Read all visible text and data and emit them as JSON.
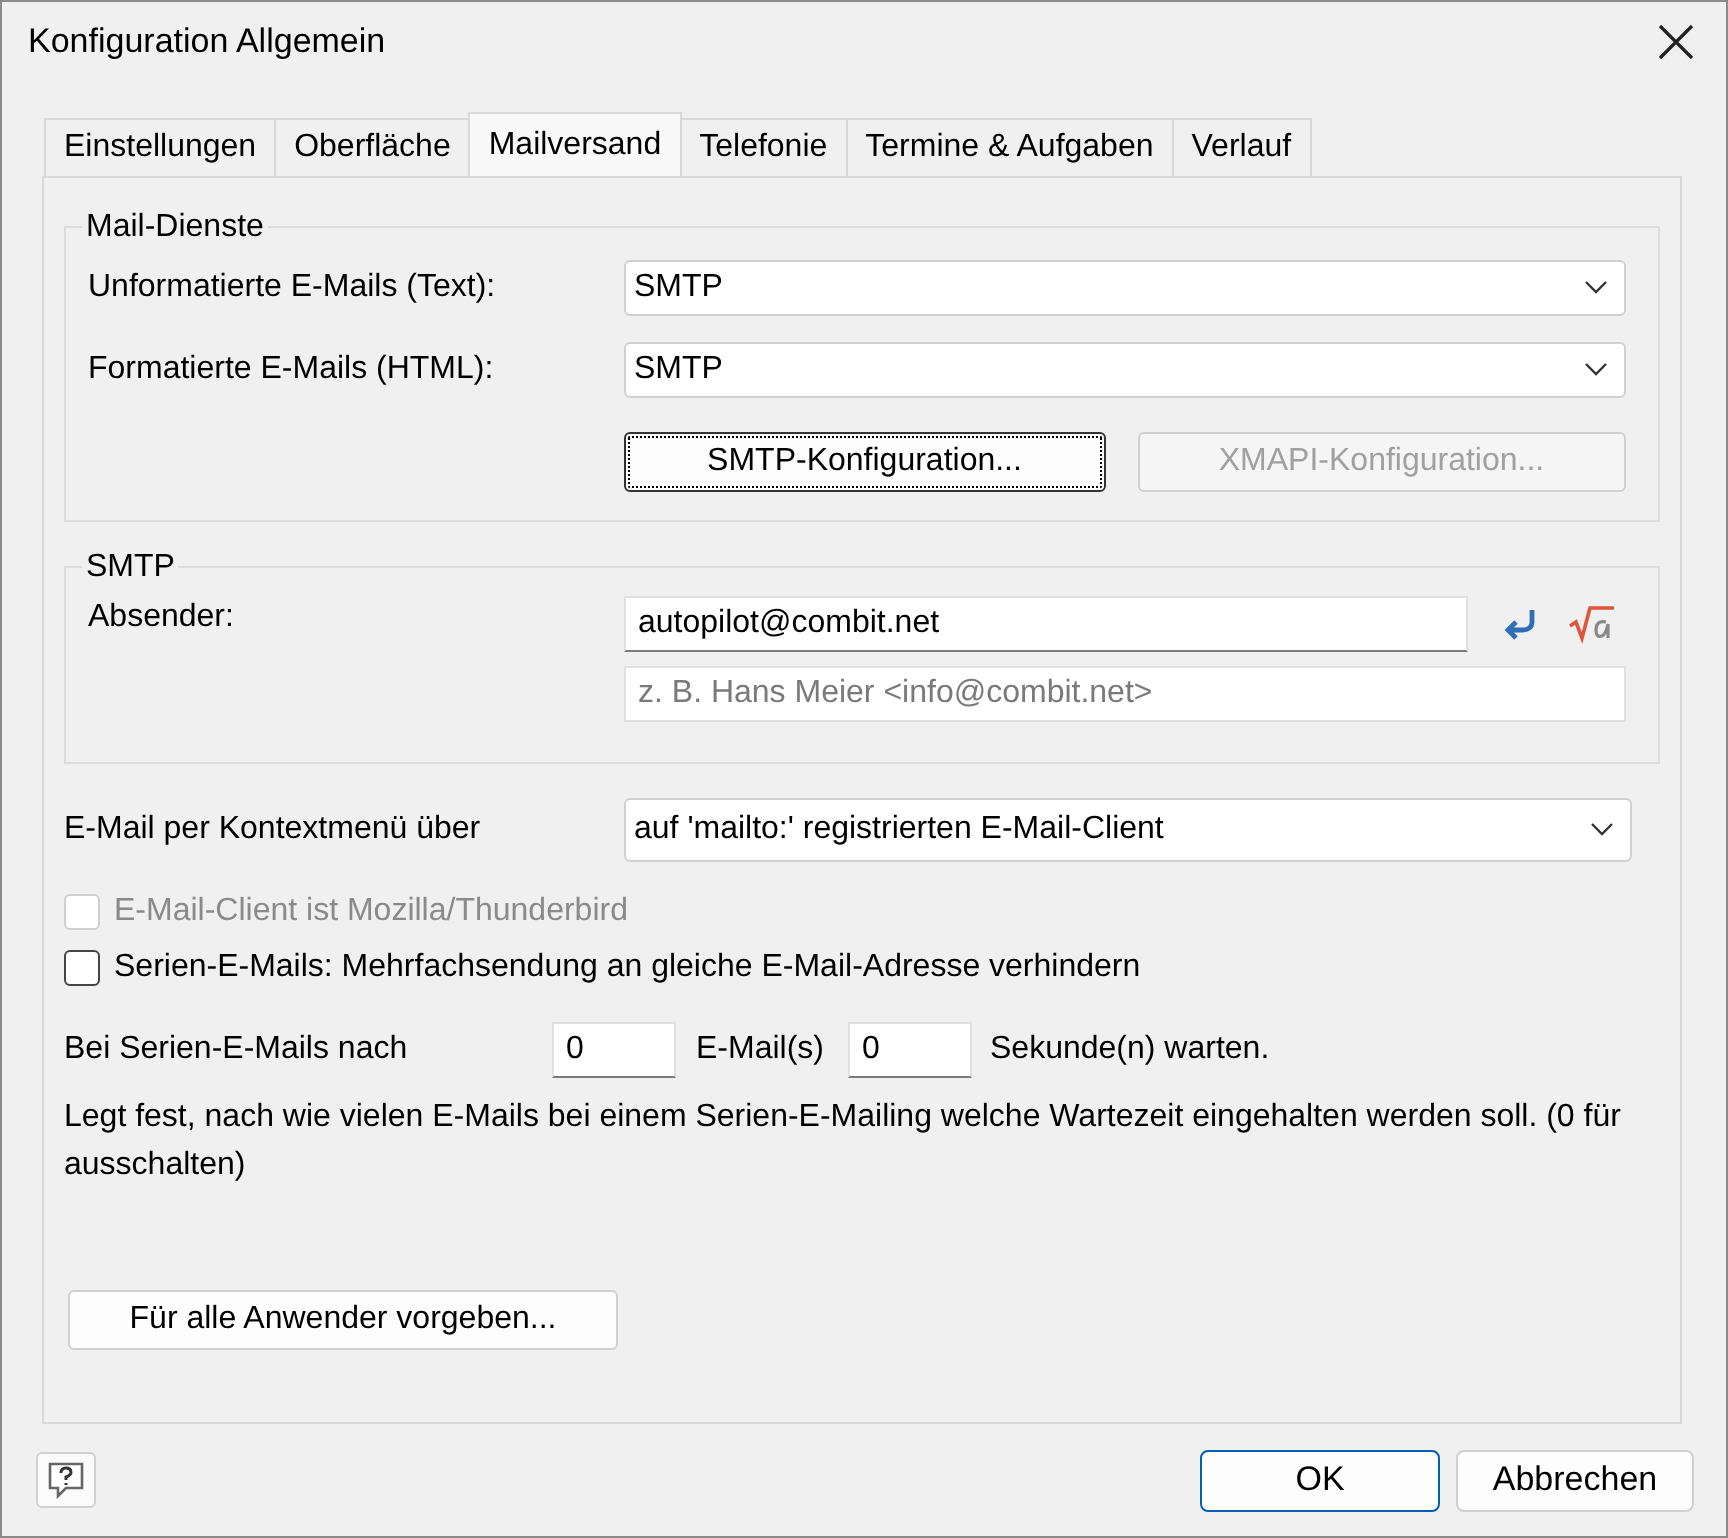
{
  "window": {
    "title": "Konfiguration Allgemein"
  },
  "tabs": [
    {
      "label": "Einstellungen",
      "selected": false
    },
    {
      "label": "Oberfläche",
      "selected": false
    },
    {
      "label": "Mailversand",
      "selected": true
    },
    {
      "label": "Telefonie",
      "selected": false
    },
    {
      "label": "Termine & Aufgaben",
      "selected": false
    },
    {
      "label": "Verlauf",
      "selected": false
    }
  ],
  "mail_services": {
    "title": "Mail-Dienste",
    "rows": [
      {
        "label": "Unformatierte E-Mails (Text):",
        "value": "SMTP"
      },
      {
        "label": "Formatierte E-Mails (HTML):",
        "value": "SMTP"
      }
    ],
    "buttons": [
      {
        "label": "SMTP-Konfiguration...",
        "disabled": false,
        "focused": true
      },
      {
        "label": "XMAPI-Konfiguration...",
        "disabled": true,
        "focused": false
      }
    ]
  },
  "smtp": {
    "title": "SMTP",
    "sender_label": "Absender:",
    "sender_value": "autopilot@combit.net",
    "name_placeholder": "z. B. Hans Meier <info@combit.net>"
  },
  "context_menu": {
    "label": "E-Mail per Kontextmenü über",
    "value": "auf 'mailto:' registrierten E-Mail-Client"
  },
  "checkboxes": [
    {
      "label": "E-Mail-Client ist Mozilla/Thunderbird",
      "checked": false,
      "disabled": true
    },
    {
      "label": "Serien-E-Mails: Mehrfachsendung an gleiche E-Mail-Adresse verhindern",
      "checked": false,
      "disabled": false
    }
  ],
  "wait": {
    "label": "Bei Serien-E-Mails nach",
    "emails_value": "0",
    "emails_label": "E-Mail(s)",
    "seconds_value": "0",
    "seconds_label": "Sekunde(n) warten."
  },
  "description": "Legt fest, nach wie vielen E-Mails bei einem Serien-E-Mailing welche Wartezeit eingehalten werden soll. (0 für ausschalten)",
  "defaults_button": "Für alle Anwender vorgeben...",
  "footer": {
    "buttons": [
      {
        "label": "OK",
        "default": true
      },
      {
        "label": "Abbrechen",
        "default": false
      }
    ]
  }
}
